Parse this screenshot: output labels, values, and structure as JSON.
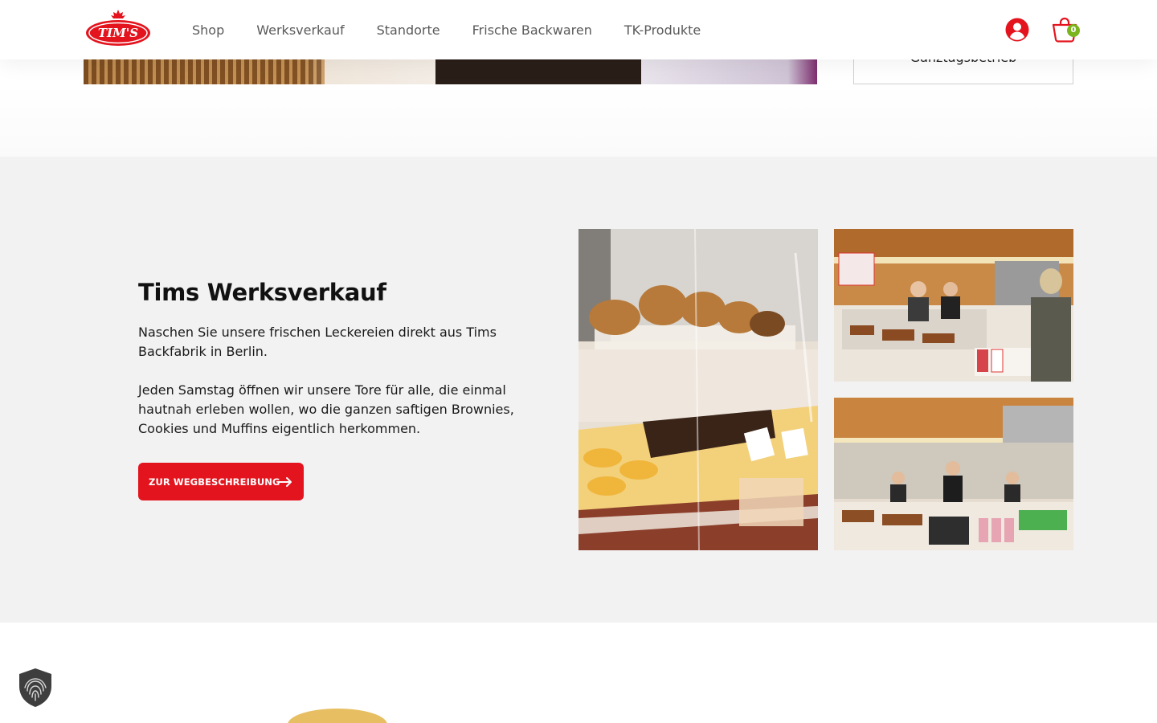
{
  "brand": {
    "logo_text": "TIM'S"
  },
  "nav": {
    "items": [
      {
        "label": "Shop"
      },
      {
        "label": "Werksverkauf"
      },
      {
        "label": "Standorte"
      },
      {
        "label": "Frische Backwaren"
      },
      {
        "label": "TK-Produkte"
      }
    ]
  },
  "header": {
    "cart_count": "0"
  },
  "hours": {
    "label": "Ganztagsbetrieb"
  },
  "werksverkauf": {
    "title": "Tims Werksverkauf",
    "paragraph_1": "Naschen Sie unsere frischen Leckereien direkt aus Tims Backfabrik in Berlin.",
    "paragraph_2": "Jeden Samstag öffnen wir unsere Tore für alle, die einmal hautnah erleben wollen, wo die ganzen saftigen Brownies, Cookies und Muffins eigentlich herkommen.",
    "cta_label": "ZUR WEGBESCHREIBUNG"
  },
  "colors": {
    "brand_red": "#e3141e",
    "badge_green": "#7ab51d",
    "section_bg": "#f2f2f2"
  },
  "icons": [
    "account-icon",
    "cart-icon",
    "arrow-right-icon",
    "fingerprint-icon"
  ]
}
